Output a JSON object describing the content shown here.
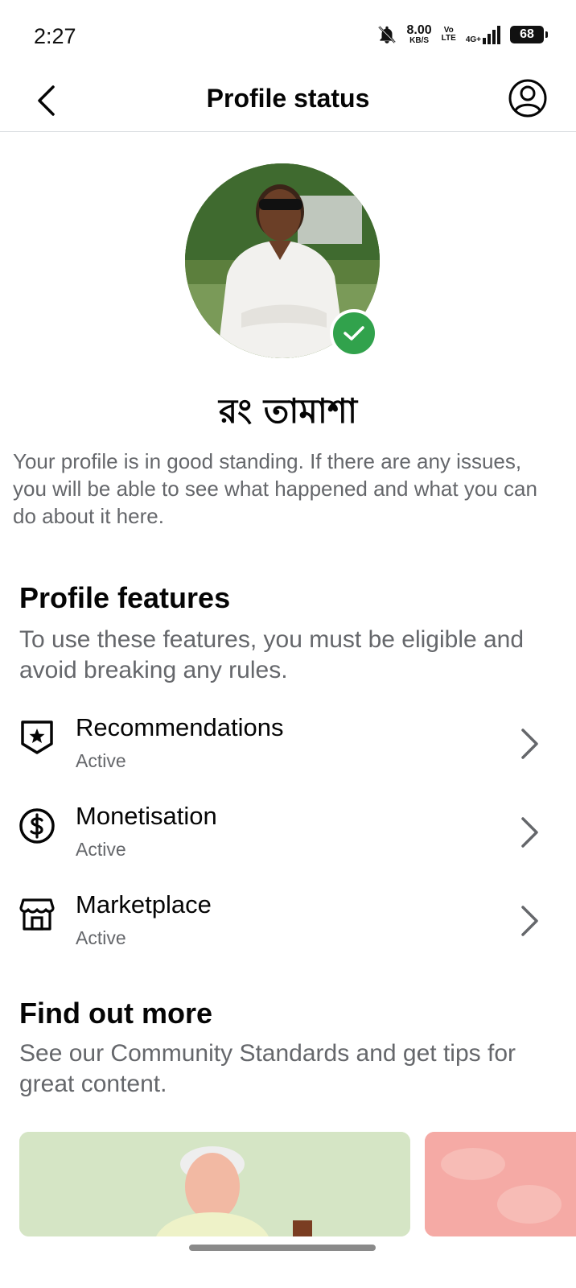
{
  "status_bar": {
    "time": "2:27",
    "net_speed": "8.00",
    "net_unit": "KB/S",
    "volte_top": "Vo",
    "volte_bottom": "LTE",
    "network": "4G+",
    "battery": "68"
  },
  "header": {
    "title": "Profile status"
  },
  "profile": {
    "name": "রং তামাশা",
    "verified_color": "#31a24c",
    "status_text": "Your profile is in good standing. If there are any issues, you will be able to see what happened and what you can do about it here."
  },
  "features_section": {
    "title": "Profile features",
    "description": "To use these features, you must be eligible and avoid breaking any rules.",
    "items": [
      {
        "name": "Recommendations",
        "status": "Active",
        "icon": "shield-star-icon"
      },
      {
        "name": "Monetisation",
        "status": "Active",
        "icon": "dollar-circle-icon"
      },
      {
        "name": "Marketplace",
        "status": "Active",
        "icon": "storefront-icon"
      }
    ]
  },
  "find_more_section": {
    "title": "Find out more",
    "description": "See our Community Standards and get tips for great content."
  }
}
